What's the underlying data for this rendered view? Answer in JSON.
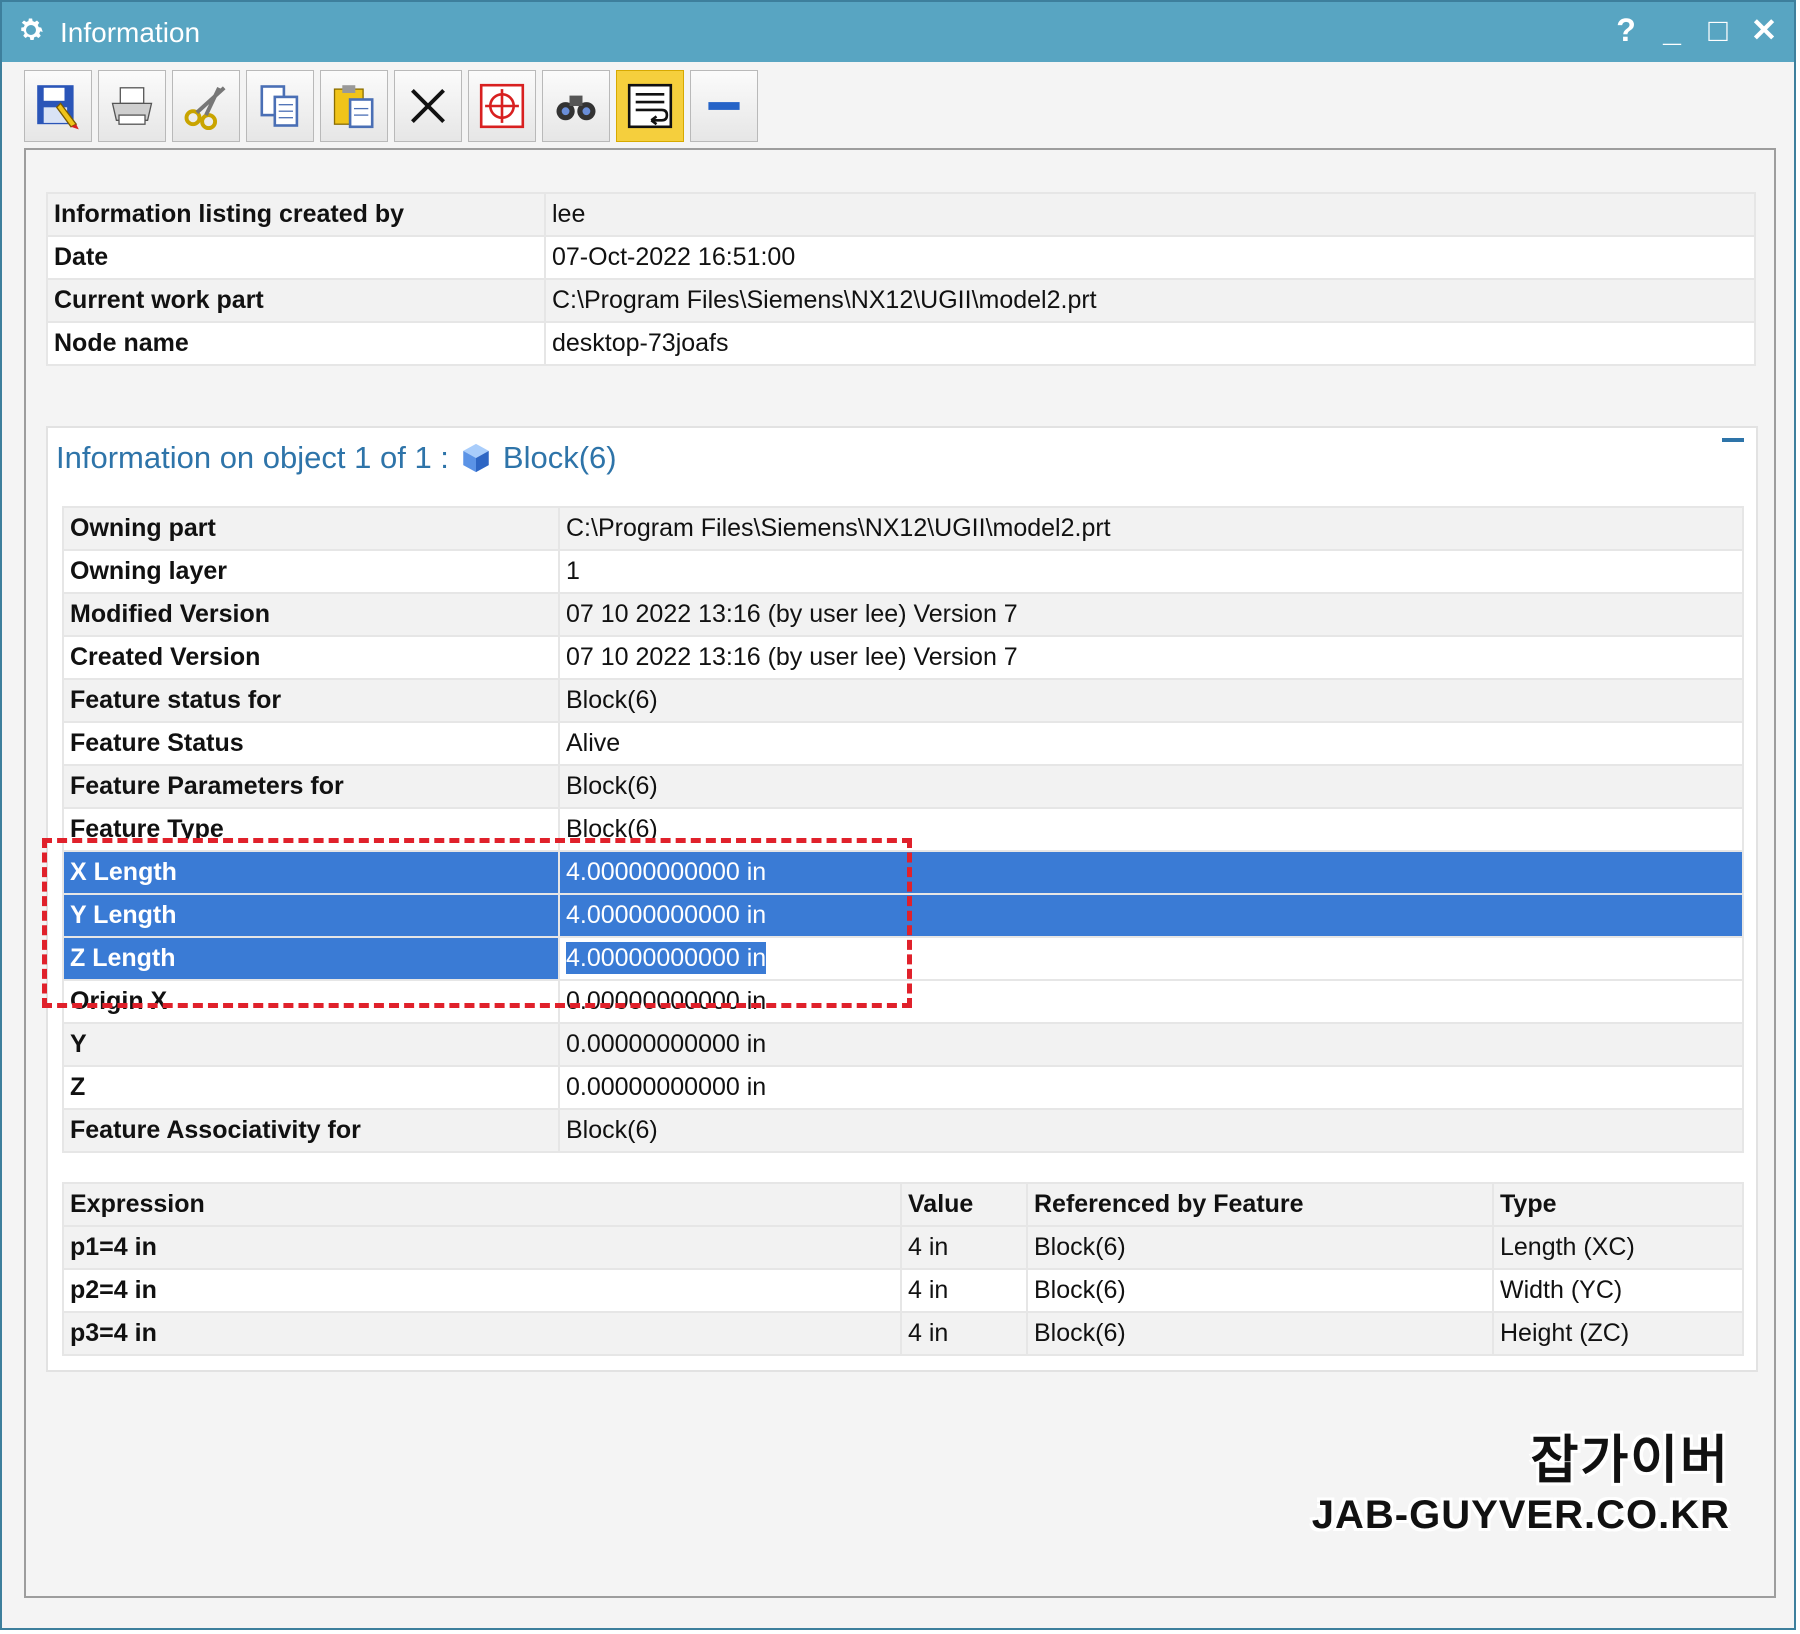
{
  "window": {
    "title": "Information",
    "help_label": "?",
    "minimize_label": "_",
    "maximize_label": "□",
    "close_label": "✕"
  },
  "toolbar": {
    "items": [
      {
        "name": "save",
        "icon": "save-icon"
      },
      {
        "name": "print",
        "icon": "printer-icon"
      },
      {
        "name": "cut",
        "icon": "scissors-icon"
      },
      {
        "name": "copy",
        "icon": "copy-icon"
      },
      {
        "name": "paste",
        "icon": "paste-icon"
      },
      {
        "name": "delete",
        "icon": "delete-x-icon"
      },
      {
        "name": "select",
        "icon": "crosshair-icon"
      },
      {
        "name": "find",
        "icon": "binoculars-icon"
      },
      {
        "name": "wrap",
        "icon": "word-wrap-icon",
        "active": true
      },
      {
        "name": "collapse",
        "icon": "minus-icon"
      }
    ]
  },
  "header_info": {
    "rows": [
      {
        "key": "Information listing created by",
        "value": "lee"
      },
      {
        "key": "Date",
        "value": "07-Oct-2022 16:51:00"
      },
      {
        "key": "Current work part",
        "value": "C:\\Program Files\\Siemens\\NX12\\UGII\\model2.prt"
      },
      {
        "key": "Node name",
        "value": "desktop-73joafs"
      }
    ]
  },
  "object": {
    "heading_prefix": "Information on object 1 of 1 :",
    "heading_name": "Block(6)",
    "attributes": [
      {
        "key": "Owning part",
        "value": "C:\\Program Files\\Siemens\\NX12\\UGII\\model2.prt"
      },
      {
        "key": "Owning layer",
        "value": "1"
      },
      {
        "key": "Modified Version",
        "value": "07 10 2022 13:16 (by user lee) Version 7"
      },
      {
        "key": "Created Version",
        "value": "07 10 2022 13:16 (by user lee) Version 7"
      },
      {
        "key": "Feature status for",
        "value": "Block(6)"
      },
      {
        "key": "Feature Status",
        "value": "Alive"
      },
      {
        "key": "Feature Parameters for",
        "value": "Block(6)"
      },
      {
        "key": "Feature Type",
        "value": "Block(6)"
      },
      {
        "key": "X Length",
        "value": "4.00000000000 in",
        "selected": true
      },
      {
        "key": "Y Length",
        "value": "4.00000000000 in",
        "selected": true
      },
      {
        "key": "Z Length",
        "value": "4.00000000000 in",
        "selected": true
      },
      {
        "key": "Origin X",
        "value": "0.00000000000 in"
      },
      {
        "key": "Y",
        "value": "0.00000000000 in"
      },
      {
        "key": "Z",
        "value": "0.00000000000 in"
      },
      {
        "key": "Feature Associativity for",
        "value": "Block(6)"
      }
    ],
    "expressions": {
      "headers": [
        "Expression",
        "Value",
        "Referenced by Feature",
        "Type"
      ],
      "rows": [
        [
          "p1=4 in",
          "4 in",
          "Block(6)",
          "Length (XC)"
        ],
        [
          "p2=4 in",
          "4 in",
          "Block(6)",
          "Width (YC)"
        ],
        [
          "p3=4 in",
          "4 in",
          "Block(6)",
          "Height (ZC)"
        ]
      ]
    }
  },
  "watermark": {
    "line1": "잡가이버",
    "line2": "JAB-GUYVER.CO.KR"
  },
  "colors": {
    "titlebar": "#58a5c2",
    "selection": "#3a7bd5",
    "annotation": "#e0212b",
    "heading": "#2e74a9"
  }
}
